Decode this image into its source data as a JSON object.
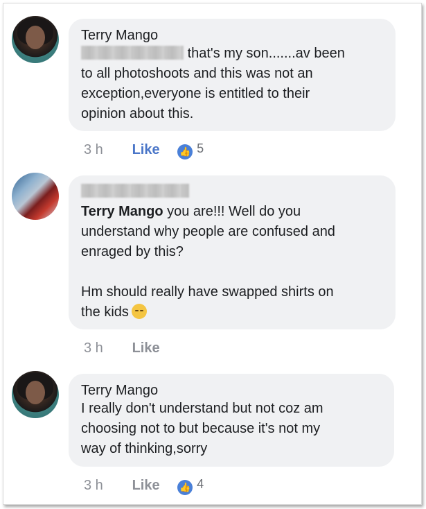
{
  "comments": [
    {
      "author": "Terry Mango",
      "text_lines": [
        "that's my son.......av been",
        "to all photoshoots and this was not an",
        "exception,everyone is entitled to their",
        "opinion about this."
      ],
      "time": "3 h",
      "like_label": "Like",
      "reaction_count": "5"
    },
    {
      "mention": "Terry Mango",
      "text_first": "you are!!! Well do you",
      "text_lines": [
        "understand why people are confused and",
        "enraged by this?"
      ],
      "text_para2_lines": [
        "Hm should really have swapped shirts on",
        "the kids"
      ],
      "time": "3 h",
      "like_label": "Like"
    },
    {
      "author": "Terry Mango",
      "text_lines": [
        "I really don't understand but not coz am",
        "choosing not to but because it's not my",
        "way of thinking,sorry"
      ],
      "time": "3 h",
      "like_label": "Like",
      "reaction_count": "4"
    }
  ],
  "colors": {
    "bubble": "#f0f1f3",
    "like_blue": "#4a76c8",
    "meta_gray": "#8d9097",
    "reaction_blue": "#4a80d8"
  },
  "icons": {
    "reaction": "like-thumb-icon",
    "emoji": "disappointed-face-emoji"
  }
}
